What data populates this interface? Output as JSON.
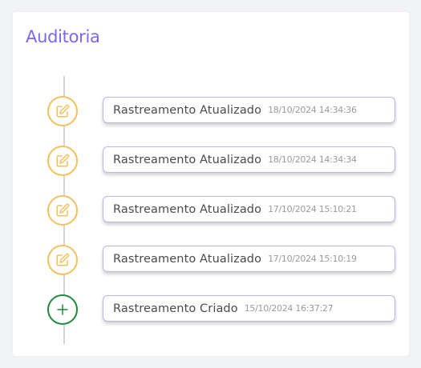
{
  "card": {
    "title": "Auditoria"
  },
  "timeline": {
    "items": [
      {
        "event": "Rastreamento Atualizado",
        "timestamp": "18/10/2024 14:34:36",
        "icon": "edit-icon",
        "color": "#f2c15b"
      },
      {
        "event": "Rastreamento Atualizado",
        "timestamp": "18/10/2024 14:34:34",
        "icon": "edit-icon",
        "color": "#f2c15b"
      },
      {
        "event": "Rastreamento Atualizado",
        "timestamp": "17/10/2024 15:10:21",
        "icon": "edit-icon",
        "color": "#f2c15b"
      },
      {
        "event": "Rastreamento Atualizado",
        "timestamp": "17/10/2024 15:10:19",
        "icon": "edit-icon",
        "color": "#f2c15b"
      },
      {
        "event": "Rastreamento Criado",
        "timestamp": "15/10/2024 16:37:27",
        "icon": "plus-icon",
        "color": "#1e8a3c"
      }
    ]
  },
  "colors": {
    "title": "#7b68ee",
    "box_border": "#b9b4ee",
    "edit": "#f2c15b",
    "create": "#1e8a3c"
  }
}
